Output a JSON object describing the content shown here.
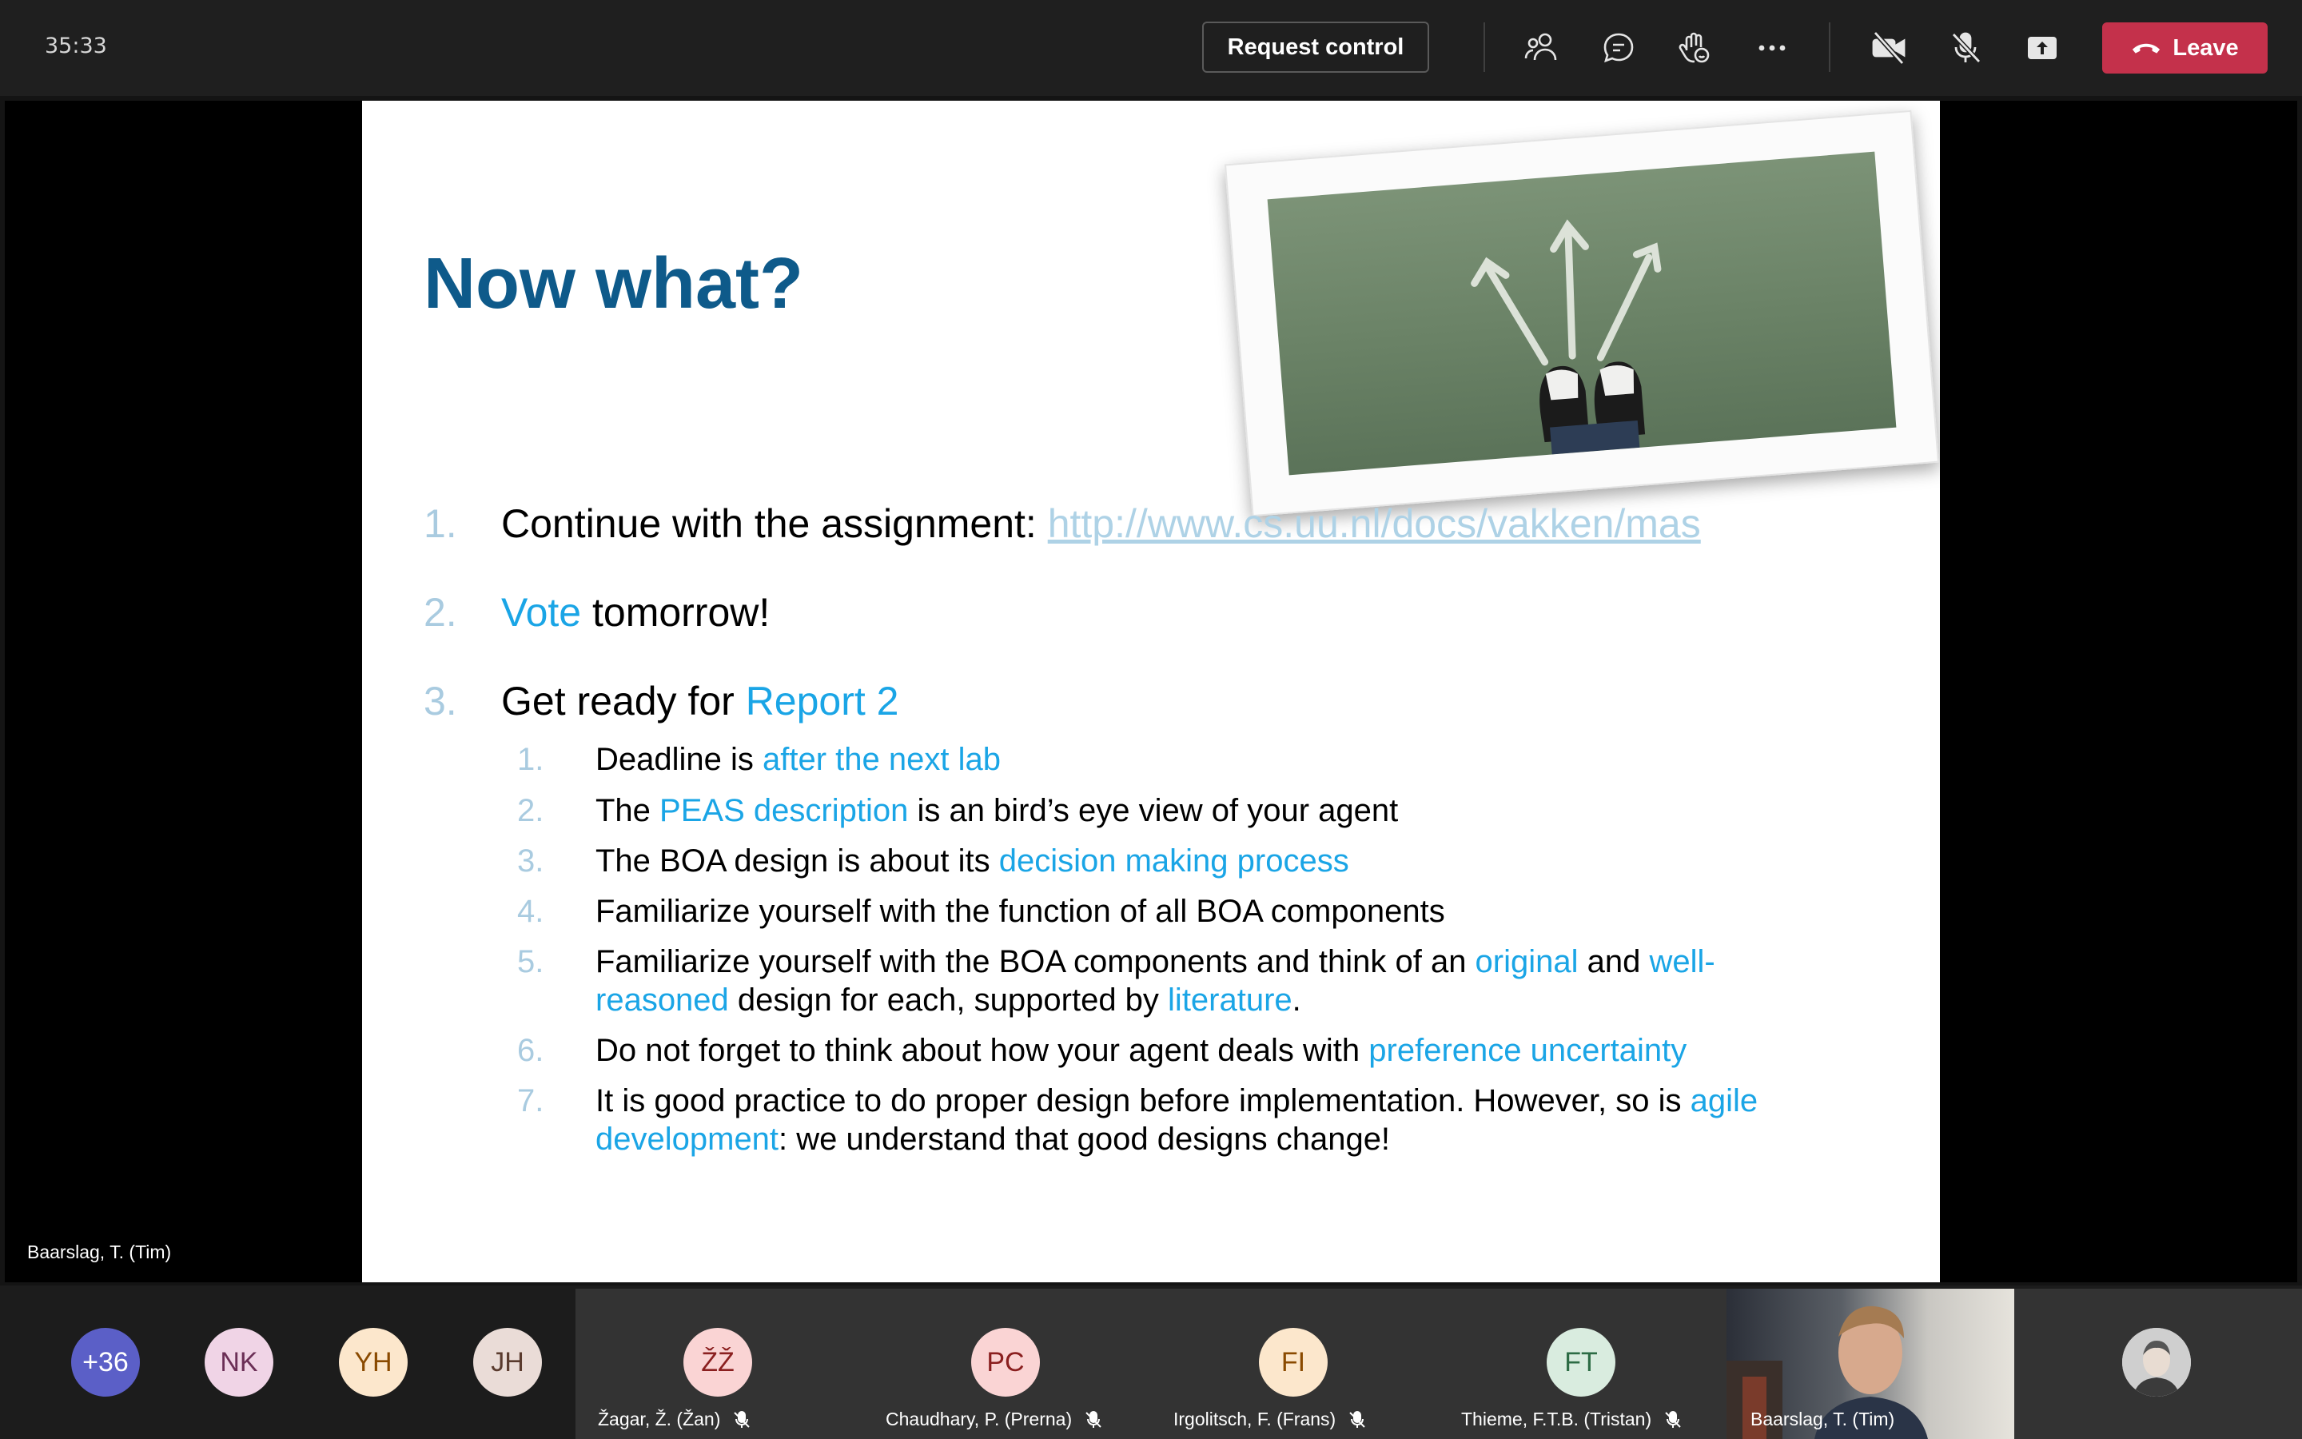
{
  "meeting": {
    "timer": "35:33",
    "request_control_label": "Request control",
    "leave_label": "Leave",
    "toolbar_icons": [
      "people-icon",
      "chat-icon",
      "raise-hand-icon",
      "more-icon",
      "camera-off-icon",
      "mic-off-icon",
      "share-icon"
    ],
    "leave_color": "#c4314b"
  },
  "presenter": {
    "name": "Baarslag, T. (Tim)"
  },
  "slide": {
    "title": "Now what?",
    "title_color": "#0e5a8a",
    "accent_color": "#1aa5e6",
    "item1": {
      "num": "1.",
      "text": "Continue with the assignment: ",
      "link": "http://www.cs.uu.nl/docs/vakken/mas"
    },
    "item2": {
      "num": "2.",
      "highlight": "Vote",
      "text": " tomorrow!"
    },
    "item3": {
      "num": "3.",
      "text": "Get ready for ",
      "highlight": "Report 2"
    },
    "sub": {
      "s1": {
        "num": "1.",
        "a": "Deadline is ",
        "h1": "after the next lab"
      },
      "s2": {
        "num": "2.",
        "a": "The ",
        "h1": "PEAS description",
        "b": " is an bird’s eye view of your agent"
      },
      "s3": {
        "num": "3.",
        "a": "The BOA design is about its ",
        "h1": "decision making process"
      },
      "s4": {
        "num": "4.",
        "a": "Familiarize yourself with the function of all BOA components"
      },
      "s5": {
        "num": "5.",
        "a": "Familiarize yourself with the BOA components and think of an ",
        "h1": "original",
        "b": " and ",
        "h2": "well-reasoned",
        "c": " design for each, supported by ",
        "h3": "literature",
        "d": "."
      },
      "s6": {
        "num": "6.",
        "a": "Do not forget to think about how your agent deals with ",
        "h1": "preference uncertainty"
      },
      "s7": {
        "num": "7.",
        "a": "It is good practice to do proper design before implementation. However, so is ",
        "h1": "agile development",
        "b": ": we understand that good designs change!"
      }
    }
  },
  "participants": {
    "overflow": "+36",
    "p1": {
      "initials": "NK"
    },
    "p2": {
      "initials": "YH"
    },
    "p3": {
      "initials": "JH"
    },
    "p4": {
      "initials": "ŽŽ",
      "name": "Žagar, Ž. (Žan)"
    },
    "p5": {
      "initials": "PC",
      "name": "Chaudhary, P. (Prerna)"
    },
    "p6": {
      "initials": "FI",
      "name": "Irgolitsch, F. (Frans)"
    },
    "p7": {
      "initials": "FT",
      "name": "Thieme, F.T.B. (Tristan)"
    },
    "p8": {
      "name": "Baarslag, T. (Tim)"
    }
  }
}
